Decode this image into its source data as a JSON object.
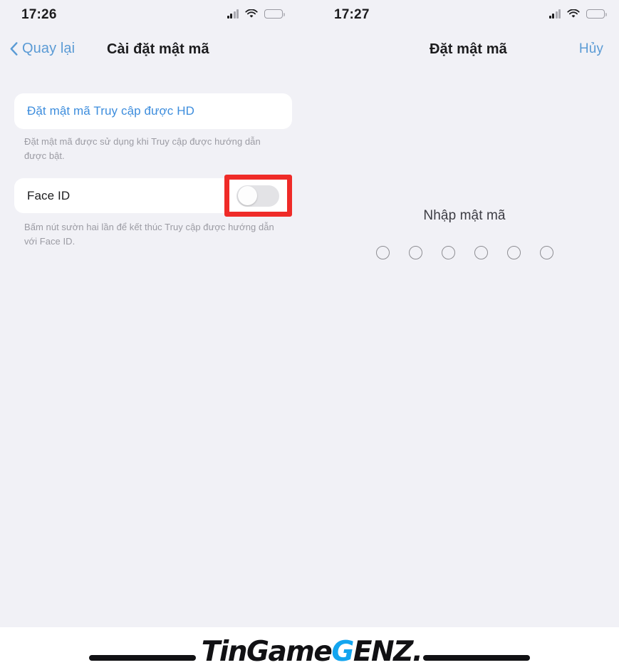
{
  "left_screen": {
    "status_bar": {
      "time": "17:26",
      "icons": [
        "cellular-signal-icon",
        "wifi-icon",
        "battery-icon"
      ]
    },
    "nav": {
      "back_label": "Quay lại",
      "back_icon": "chevron-left-icon",
      "title": "Cài đặt mật mã"
    },
    "rows": [
      {
        "label": "Đặt mật mã Truy cập được HD",
        "type": "link",
        "footnote": "Đặt mật mã được sử dụng khi Truy cập được hướng dẫn được bật."
      },
      {
        "label": "Face ID",
        "type": "toggle",
        "toggle_state": "off",
        "footnote": "Bấm nút sườn hai lần để kết thúc Truy cập được hướng dẫn với Face ID."
      }
    ],
    "annotation": {
      "name": "red-highlight-box",
      "color": "#ef2b28",
      "target": "Face ID toggle"
    }
  },
  "right_screen": {
    "status_bar": {
      "time": "17:27",
      "icons": [
        "cellular-signal-icon",
        "wifi-icon",
        "battery-icon"
      ]
    },
    "nav": {
      "title": "Đặt mật mã",
      "cancel_label": "Hủy"
    },
    "passcode": {
      "prompt": "Nhập mật mã",
      "digit_count": 6,
      "filled_count": 0
    }
  },
  "watermark": {
    "text_part1": "TinGame",
    "text_part2": "G",
    "text_part3": "ENZ.",
    "accent_color": "#13a5ef",
    "dark_color": "#111114"
  },
  "colors": {
    "page_background": "#f1f1f6",
    "card_background": "#ffffff",
    "accent_blue": "#5b9bd5",
    "link_blue": "#3d8ddd",
    "footnote_gray": "#9b9ba3",
    "toggle_track_off": "#e3e3e6"
  }
}
